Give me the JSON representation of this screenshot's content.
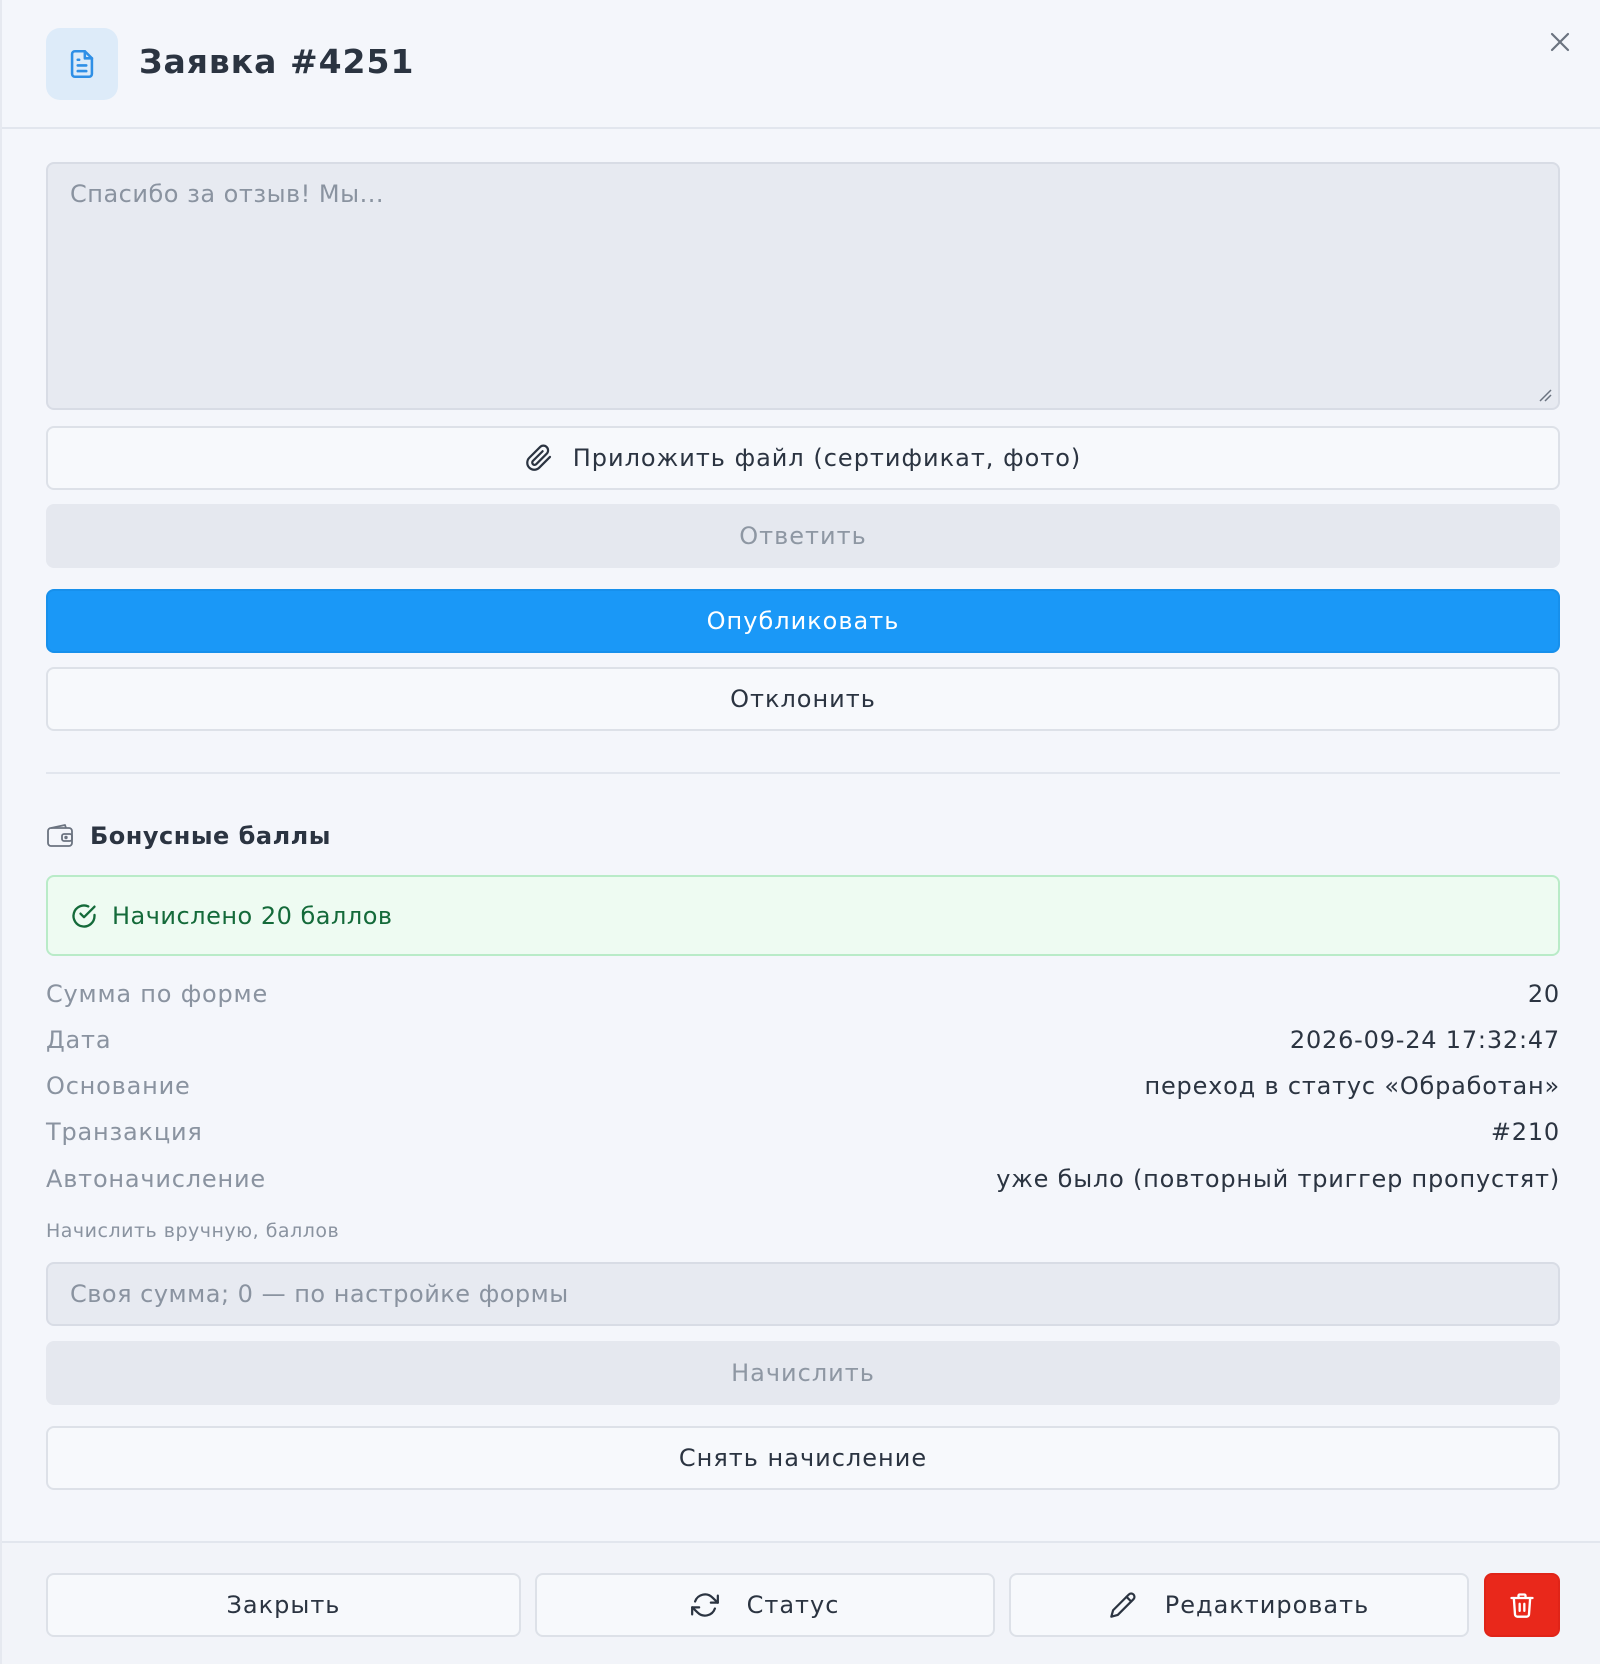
{
  "header": {
    "title": "Заявка #4251",
    "doc_icon": "file-text-icon",
    "close_icon": "close-icon"
  },
  "reply": {
    "placeholder": "Спасибо за отзыв! Мы...",
    "attach_label": "Приложить файл (сертификат, фото)",
    "attach_icon": "paperclip-icon",
    "reply_label": "Ответить",
    "publish_label": "Опубликовать",
    "reject_label": "Отклонить"
  },
  "bonus": {
    "title": "Бонусные баллы",
    "title_icon": "wallet-icon",
    "success_text": "Начислено 20 баллов",
    "success_icon": "check-circle-icon",
    "details": [
      {
        "key": "Сумма по форме",
        "value": "20"
      },
      {
        "key": "Дата",
        "value": "2026-09-24 17:32:47"
      },
      {
        "key": "Основание",
        "value": "переход в статус «Обработан»"
      },
      {
        "key": "Транзакция",
        "value": "#210"
      },
      {
        "key": "Автоначисление",
        "value": "уже было (повторный триггер пропустят)"
      }
    ],
    "manual_label": "Начислить вручную, баллов",
    "manual_placeholder": "Своя сумма; 0 — по настройке формы",
    "accrue_label": "Начислить",
    "revoke_label": "Снять начисление"
  },
  "footer": {
    "close_label": "Закрыть",
    "status_label": "Статус",
    "status_icon": "refresh-icon",
    "edit_label": "Редактировать",
    "edit_icon": "pencil-icon",
    "delete_icon": "trash-icon"
  },
  "colors": {
    "primary": "#1a98f7",
    "danger": "#e9281b",
    "success_bg": "#eefbf2",
    "success_text": "#146a3a"
  }
}
